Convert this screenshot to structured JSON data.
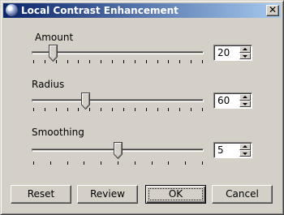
{
  "window": {
    "title": "Local Contrast Enhancement",
    "close_glyph": "✕",
    "icon": "app-icon"
  },
  "sliders": [
    {
      "name": "amount",
      "label": "Amount",
      "value": "20",
      "position_fraction": 0.12,
      "tick_count": 16
    },
    {
      "name": "radius",
      "label": "Radius",
      "value": "60",
      "position_fraction": 0.31,
      "tick_count": 16
    },
    {
      "name": "smoothing",
      "label": "Smoothing",
      "value": "5",
      "position_fraction": 0.5,
      "tick_count": 11
    }
  ],
  "buttons": {
    "reset": "Reset",
    "review": "Review",
    "ok": "OK",
    "cancel": "Cancel"
  }
}
